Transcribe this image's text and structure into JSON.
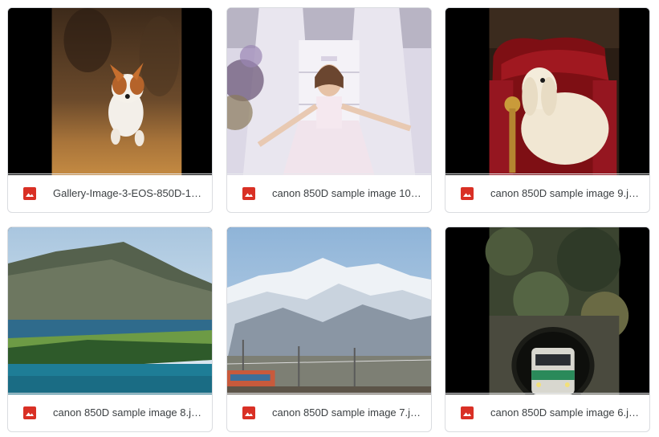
{
  "files": [
    {
      "name": "Gallery-Image-3-EOS-850D-14...",
      "icon": "image-file-icon",
      "thumb": "jumping-dog"
    },
    {
      "name": "canon 850D sample image 10....",
      "icon": "image-file-icon",
      "thumb": "girl-staircase"
    },
    {
      "name": "canon 850D sample image 9.jpg",
      "icon": "image-file-icon",
      "thumb": "afghan-hound-chair"
    },
    {
      "name": "canon 850D sample image 8.jpg",
      "icon": "image-file-icon",
      "thumb": "lake-mountain"
    },
    {
      "name": "canon 850D sample image 7.jpg",
      "icon": "image-file-icon",
      "thumb": "snowy-mountains-train"
    },
    {
      "name": "canon 850D sample image 6.jpg",
      "icon": "image-file-icon",
      "thumb": "train-tunnel"
    }
  ],
  "colors": {
    "icon_red": "#d93025",
    "border": "#dadce0",
    "text": "#3c4043"
  }
}
